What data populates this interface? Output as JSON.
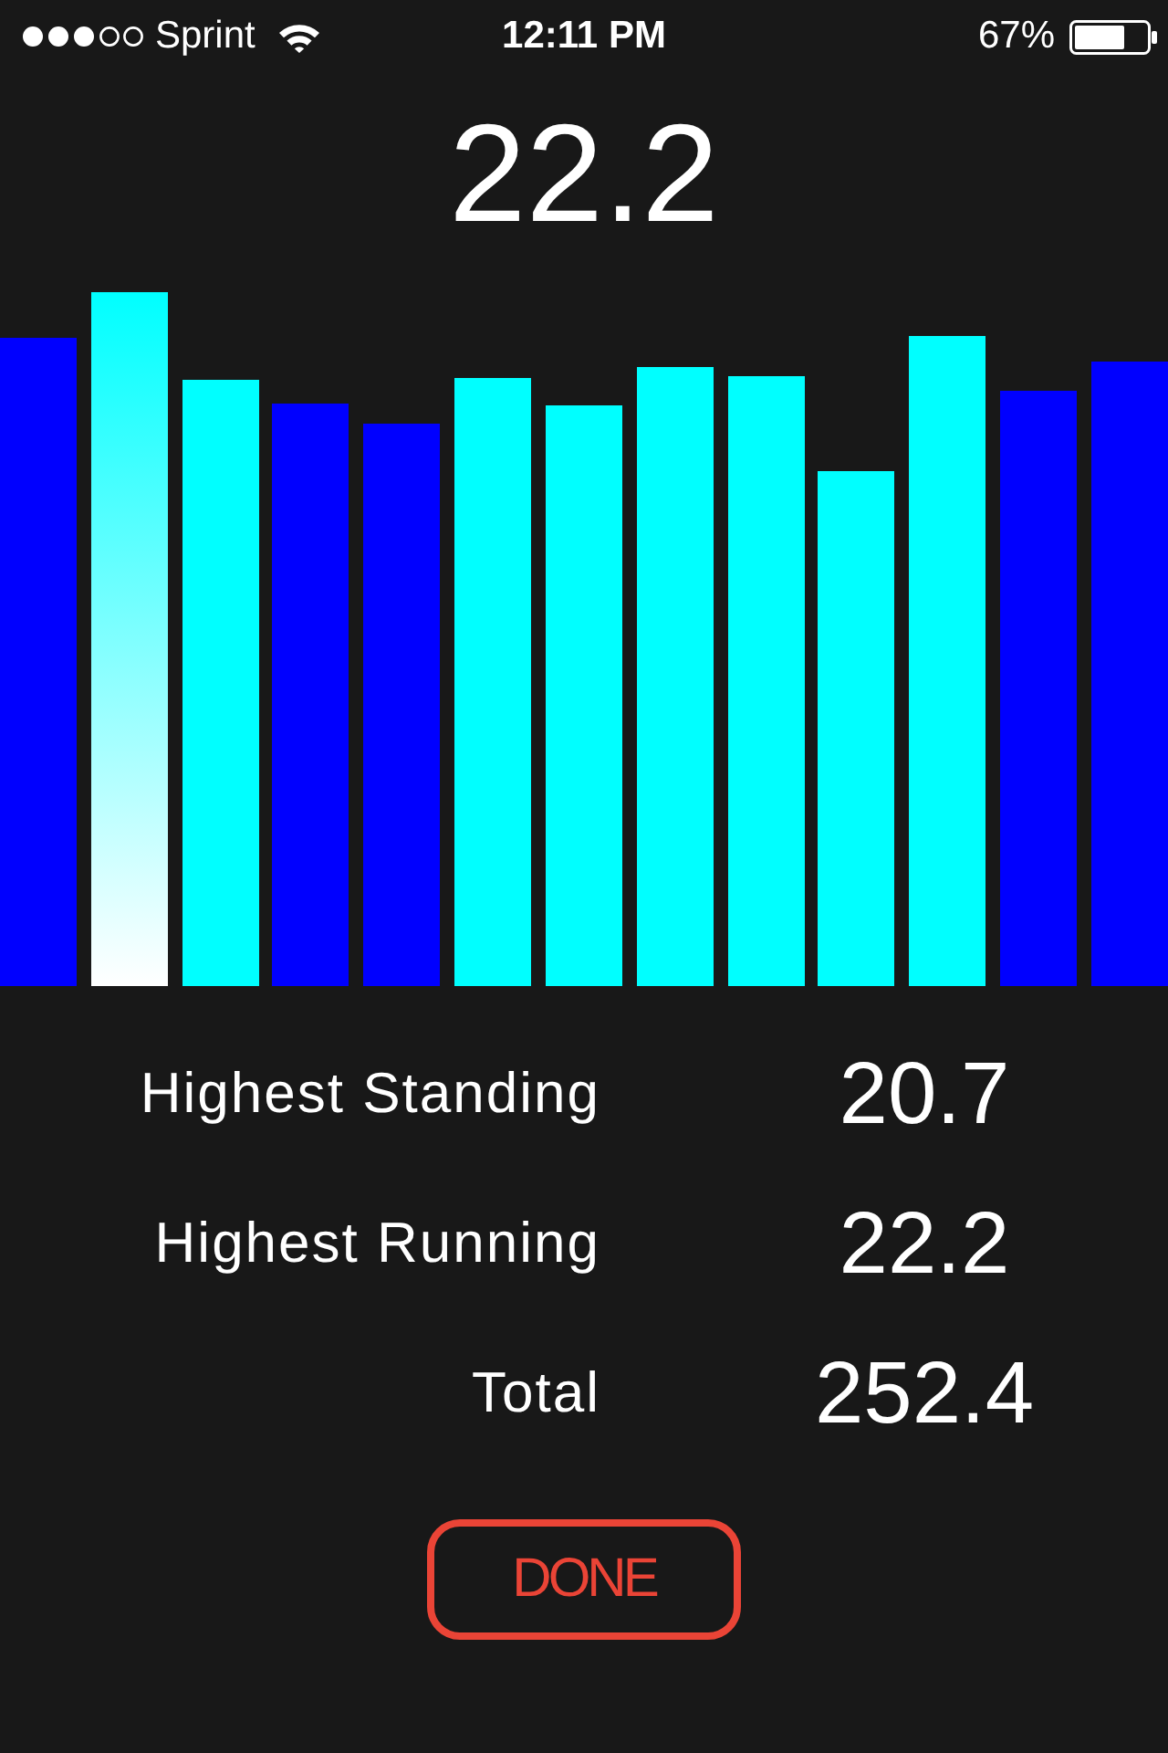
{
  "status_bar": {
    "carrier": "Sprint",
    "time": "12:11 PM",
    "battery": "67%"
  },
  "current_value": "22.2",
  "bars": [
    {
      "color": "#0000ff",
      "selected": false
    },
    {
      "color": "#00ffff",
      "selected": true
    },
    {
      "color": "#00ffff",
      "selected": false
    },
    {
      "color": "#0000ff",
      "selected": false
    },
    {
      "color": "#0000ff",
      "selected": false
    },
    {
      "color": "#00ffff",
      "selected": false
    },
    {
      "color": "#00ffff",
      "selected": false
    },
    {
      "color": "#00ffff",
      "selected": false
    },
    {
      "color": "#00ffff",
      "selected": false
    },
    {
      "color": "#00ffff",
      "selected": false
    },
    {
      "color": "#00ffff",
      "selected": false
    },
    {
      "color": "#0000ff",
      "selected": false
    },
    {
      "color": "#0000ff",
      "selected": false
    }
  ],
  "stats": [
    {
      "label": "Highest Standing",
      "value": "20.7"
    },
    {
      "label": "Highest Running",
      "value": "22.2"
    },
    {
      "label": "Total",
      "value": "252.4"
    }
  ],
  "done_button": {
    "label": "DONE"
  }
}
